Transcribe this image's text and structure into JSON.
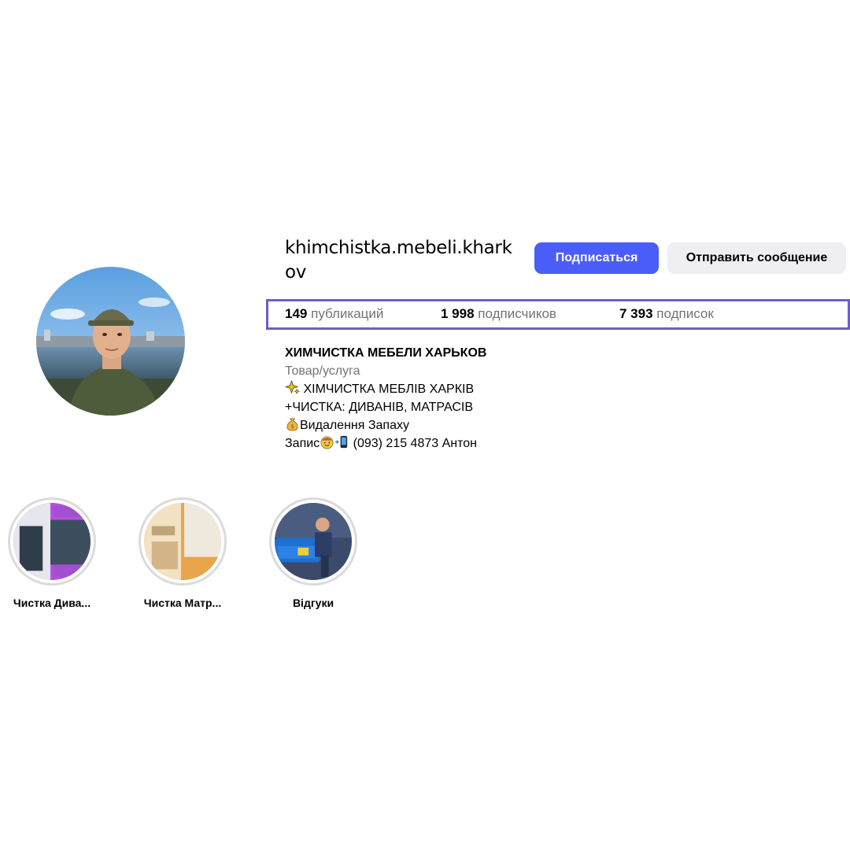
{
  "profile": {
    "username": "khimchistka.mebeli.kharkov",
    "follow_label": "Подписаться",
    "message_label": "Отправить сообщение"
  },
  "stats": {
    "posts_count": "149",
    "posts_label": "публикаций",
    "followers_count": "1 998",
    "followers_label": "подписчиков",
    "following_count": "7 393",
    "following_label": "подписок"
  },
  "bio": {
    "name": "ХИМЧИСТКА МЕБЕЛИ ХАРЬКОВ",
    "category": "Товар/услуга",
    "line1": " ХІМЧИСТКА МЕБЛІВ ХАРКІВ",
    "line2": "+ЧИСТКА: ДИВАНІВ, МАТРАСІВ",
    "line3": "Видалення Запаху",
    "line4_prefix": "Запис",
    "line4_phone": " (093) 215 4873 Антон"
  },
  "highlights": [
    {
      "label": "Чистка Дива..."
    },
    {
      "label": "Чистка Матр..."
    },
    {
      "label": "Відгуки"
    }
  ],
  "colors": {
    "accent": "#4a5df9",
    "secondary_button": "#efeff1",
    "stats_border": "#6d5fc6",
    "muted_text": "#737373"
  },
  "icons": [
    "sparkles-icon",
    "money-bag-icon",
    "face-icon",
    "phone-icon"
  ]
}
